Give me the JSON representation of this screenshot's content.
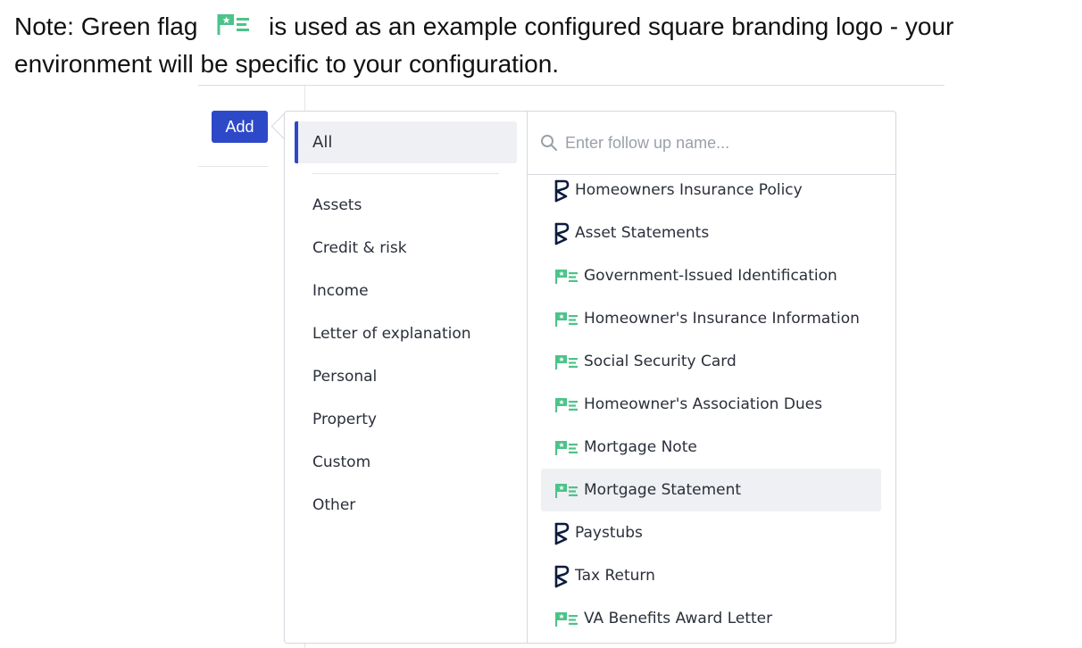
{
  "note": {
    "text_before_icon": "Note: Green flag",
    "flag_icon": "green-flag-logo-icon",
    "text_after_icon": "is used as an example configured square branding logo - your environment will be specific to your configuration."
  },
  "colors": {
    "accent": "#2d49c8",
    "flag_green": "#4cc38a",
    "brand_navy": "#0d1b3e",
    "selected_bg": "#eff0f3"
  },
  "add_button": {
    "label": "Add"
  },
  "categories": {
    "active": "All",
    "items": [
      {
        "label": "Assets"
      },
      {
        "label": "Credit & risk"
      },
      {
        "label": "Income"
      },
      {
        "label": "Letter of explanation"
      },
      {
        "label": "Personal"
      },
      {
        "label": "Property"
      },
      {
        "label": "Custom"
      },
      {
        "label": "Other"
      }
    ]
  },
  "search": {
    "placeholder": "Enter follow up name...",
    "value": "",
    "icon": "search-icon"
  },
  "follow_ups": [
    {
      "label": "Homeowners Insurance Policy",
      "icon": "brand-b-logo-icon",
      "selected": false
    },
    {
      "label": "Asset Statements",
      "icon": "brand-b-logo-icon",
      "selected": false
    },
    {
      "label": "Government-Issued Identification",
      "icon": "green-flag-logo-icon",
      "selected": false
    },
    {
      "label": "Homeowner's Insurance Information",
      "icon": "green-flag-logo-icon",
      "selected": false
    },
    {
      "label": "Social Security Card",
      "icon": "green-flag-logo-icon",
      "selected": false
    },
    {
      "label": "Homeowner's Association Dues",
      "icon": "green-flag-logo-icon",
      "selected": false
    },
    {
      "label": "Mortgage Note",
      "icon": "green-flag-logo-icon",
      "selected": false
    },
    {
      "label": "Mortgage Statement",
      "icon": "green-flag-logo-icon",
      "selected": true
    },
    {
      "label": "Paystubs",
      "icon": "brand-b-logo-icon",
      "selected": false
    },
    {
      "label": "Tax Return",
      "icon": "brand-b-logo-icon",
      "selected": false
    },
    {
      "label": "VA Benefits Award Letter",
      "icon": "green-flag-logo-icon",
      "selected": false
    }
  ]
}
